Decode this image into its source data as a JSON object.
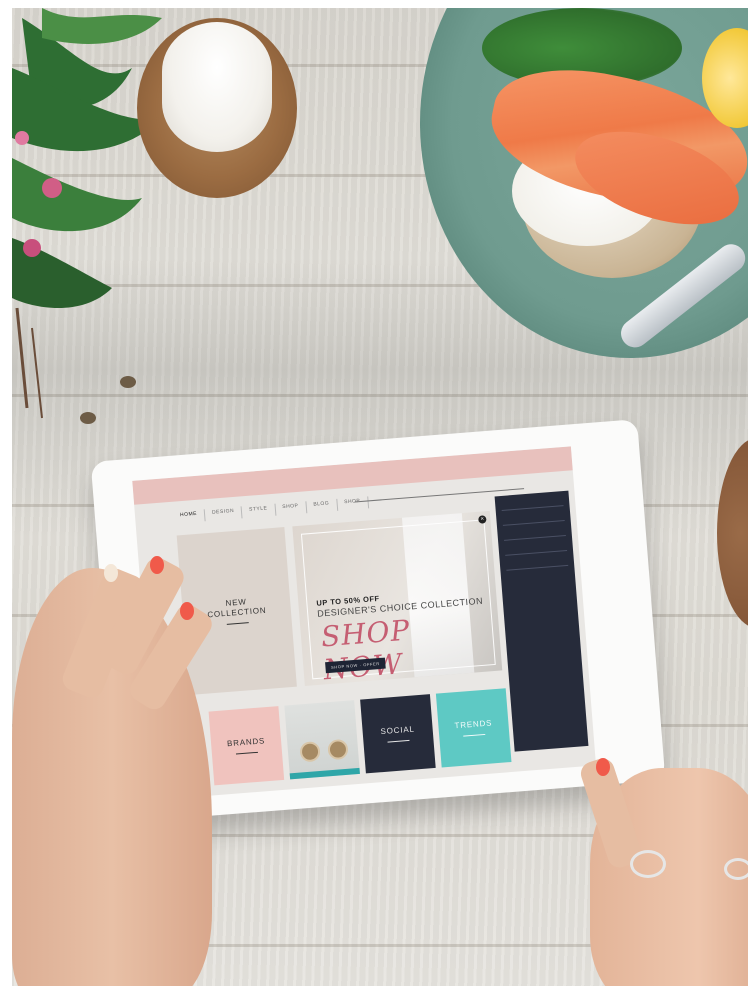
{
  "tablet_site": {
    "nav": [
      "HOME",
      "DESIGN",
      "STYLE",
      "SHOP",
      "BLOG",
      "SHOP"
    ],
    "tiles": {
      "new_collection": "NEW\nCOLLECTION",
      "brands": "BRANDS",
      "social": "SOCIAL",
      "trends": "TRENDS"
    },
    "hero": {
      "promo": "UP TO 50% OFF",
      "collection": "DESIGNER'S CHOICE COLLECTION",
      "cta": "SHOP NOW",
      "button": "SHOP NOW · OFFER"
    }
  },
  "colors": {
    "header_pink": "#e8c1bd",
    "navy": "#262b3a",
    "teal": "#5ec9c4",
    "pink_tile": "#f0c3be",
    "shop_now": "#c55e72",
    "nail_polish": "#f05a4a"
  }
}
